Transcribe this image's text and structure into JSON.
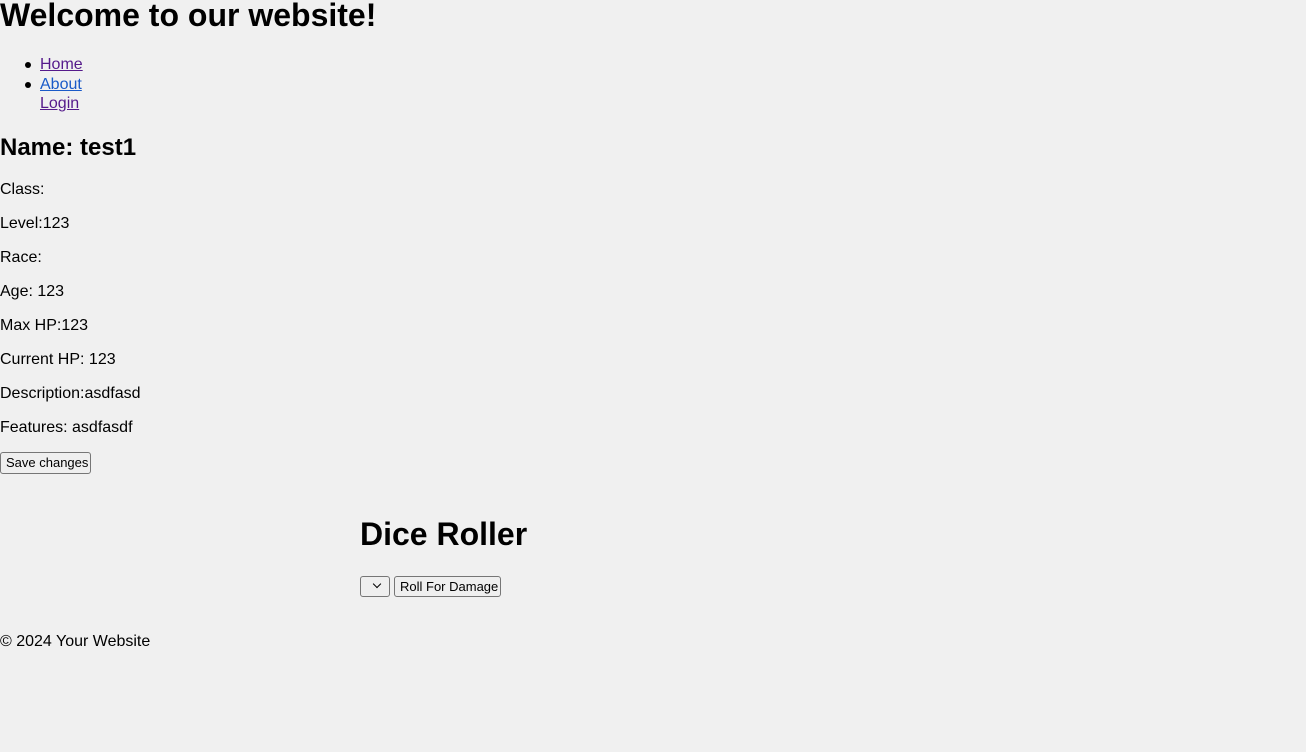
{
  "header": {
    "title": "Welcome to our website!"
  },
  "nav": {
    "items": [
      {
        "label": "Home"
      },
      {
        "label": "About"
      },
      {
        "label": "Login"
      }
    ]
  },
  "character": {
    "name": "Name: test1",
    "fields": [
      {
        "label": "Class:"
      },
      {
        "label": "Level:123"
      },
      {
        "label": "Race:"
      },
      {
        "label": "Age: 123"
      },
      {
        "label": "Max HP:123"
      },
      {
        "label": "Current HP: 123"
      },
      {
        "label": "Description:asdfasd"
      },
      {
        "label": "Features: asdfasdf"
      }
    ],
    "save_label": "Save changes"
  },
  "dice": {
    "title": "Dice Roller",
    "selected_value": "",
    "roll_label": "Roll For Damage"
  },
  "footer": {
    "text": "© 2024 Your Website"
  }
}
